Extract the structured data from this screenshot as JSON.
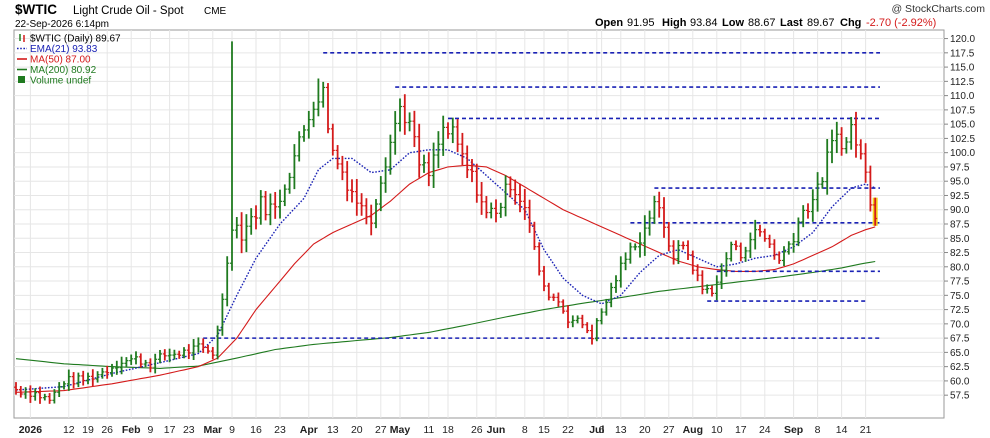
{
  "header": {
    "symbol": "$WTIC",
    "description": "Light Crude Oil - Spot",
    "exchange": "CME",
    "date": "22-Sep-2026 6:14pm",
    "copyright": "@ StockCharts.com",
    "quote": {
      "open_label": "Open",
      "open": "91.95",
      "high_label": "High",
      "high": "93.84",
      "low_label": "Low",
      "low": "88.67",
      "last_label": "Last",
      "last": "89.67",
      "chg_label": "Chg",
      "chg": "-2.70 (-2.92%)"
    }
  },
  "legend": [
    {
      "text": "$WTIC (Daily) 89.67",
      "color": "#000000",
      "marker": "bar"
    },
    {
      "text": "EMA(21) 93.83",
      "color": "#1a22b5",
      "marker": "dotted"
    },
    {
      "text": "MA(50) 87.00",
      "color": "#d41a1a",
      "marker": "line"
    },
    {
      "text": "MA(200) 80.92",
      "color": "#1f7a1f",
      "marker": "line"
    },
    {
      "text": "Volume undef",
      "color": "#1f7a1f",
      "marker": "box"
    }
  ],
  "chart_data": {
    "type": "ohlc",
    "title": "$WTIC Light Crude Oil - Spot CME",
    "ylim": [
      53.5,
      121.5
    ],
    "y_ticks": [
      57.5,
      60.0,
      62.5,
      65.0,
      67.5,
      70.0,
      72.5,
      75.0,
      77.5,
      80.0,
      82.5,
      85.0,
      87.5,
      90.0,
      92.5,
      95.0,
      97.5,
      100.0,
      102.5,
      105.0,
      107.5,
      110.0,
      112.5,
      115.0,
      117.5,
      120.0
    ],
    "y_tick_labels": [
      "57.5",
      "60.0",
      "62.5",
      "65.0",
      "67.5",
      "70.0",
      "72.5",
      "75.0",
      "77.5",
      "80.0",
      "82.5",
      "85.0",
      "87.5",
      "90.0",
      "92.5",
      "95.0",
      "97.5",
      "100.0",
      "102.5",
      "105.0",
      "107.5",
      "110.0",
      "112.5",
      "115.0",
      "117.5",
      "120.0"
    ],
    "x_range": [
      0,
      188
    ],
    "x_ticks": [
      {
        "i": 3,
        "label": "2026"
      },
      {
        "i": 11,
        "label": "12"
      },
      {
        "i": 15,
        "label": "19"
      },
      {
        "i": 19,
        "label": "26"
      },
      {
        "i": 24,
        "label": "Feb"
      },
      {
        "i": 28,
        "label": "9"
      },
      {
        "i": 32,
        "label": "17"
      },
      {
        "i": 36,
        "label": "23"
      },
      {
        "i": 41,
        "label": "Mar"
      },
      {
        "i": 45,
        "label": "9"
      },
      {
        "i": 50,
        "label": "16"
      },
      {
        "i": 55,
        "label": "23"
      },
      {
        "i": 61,
        "label": "Apr"
      },
      {
        "i": 66,
        "label": "13"
      },
      {
        "i": 71,
        "label": "20"
      },
      {
        "i": 76,
        "label": "27"
      },
      {
        "i": 80,
        "label": "May"
      },
      {
        "i": 86,
        "label": "11"
      },
      {
        "i": 90,
        "label": "18"
      },
      {
        "i": 96,
        "label": "26"
      },
      {
        "i": 100,
        "label": "Jun"
      },
      {
        "i": 106,
        "label": "8"
      },
      {
        "i": 110,
        "label": "15"
      },
      {
        "i": 115,
        "label": "22"
      },
      {
        "i": 121,
        "label": "Jul"
      },
      {
        "i": 122,
        "label": "6"
      },
      {
        "i": 126,
        "label": "13"
      },
      {
        "i": 131,
        "label": "20"
      },
      {
        "i": 136,
        "label": "27"
      },
      {
        "i": 141,
        "label": "Aug"
      },
      {
        "i": 146,
        "label": "10"
      },
      {
        "i": 151,
        "label": "17"
      },
      {
        "i": 156,
        "label": "24"
      },
      {
        "i": 162,
        "label": "Sep"
      },
      {
        "i": 167,
        "label": "8"
      },
      {
        "i": 172,
        "label": "14"
      },
      {
        "i": 177,
        "label": "21"
      }
    ],
    "close_anchors": [
      [
        0,
        58.5
      ],
      [
        4,
        57.8
      ],
      [
        7,
        56.6
      ],
      [
        10,
        60.0
      ],
      [
        14,
        60.2
      ],
      [
        18,
        61.5
      ],
      [
        22,
        63.5
      ],
      [
        25,
        63.8
      ],
      [
        28,
        63.0
      ],
      [
        31,
        64.5
      ],
      [
        35,
        65.0
      ],
      [
        38,
        65.8
      ],
      [
        41,
        64.8
      ],
      [
        43,
        74.0
      ],
      [
        45,
        88.0
      ],
      [
        47,
        86.0
      ],
      [
        51,
        91.0
      ],
      [
        54,
        90.0
      ],
      [
        57,
        97.0
      ],
      [
        60,
        104.0
      ],
      [
        62,
        109.0
      ],
      [
        64,
        110.5
      ],
      [
        66,
        100.0
      ],
      [
        69,
        95.0
      ],
      [
        72,
        90.0
      ],
      [
        74,
        89.0
      ],
      [
        77,
        99.0
      ],
      [
        80,
        108.0
      ],
      [
        82,
        105.0
      ],
      [
        84,
        98.0
      ],
      [
        86,
        96.0
      ],
      [
        89,
        104.0
      ],
      [
        91,
        103.0
      ],
      [
        94,
        97.0
      ],
      [
        96,
        94.0
      ],
      [
        98,
        89.0
      ],
      [
        101,
        91.0
      ],
      [
        103,
        95.0
      ],
      [
        106,
        91.0
      ],
      [
        108,
        83.0
      ],
      [
        110,
        76.0
      ],
      [
        113,
        74.0
      ],
      [
        115,
        71.0
      ],
      [
        118,
        70.0
      ],
      [
        120,
        68.0
      ],
      [
        122,
        72.0
      ],
      [
        124,
        76.0
      ],
      [
        126,
        80.0
      ],
      [
        128,
        83.0
      ],
      [
        131,
        86.5
      ],
      [
        133,
        92.0
      ],
      [
        135,
        86.0
      ],
      [
        137,
        82.0
      ],
      [
        139,
        84.0
      ],
      [
        141,
        80.0
      ],
      [
        143,
        76.0
      ],
      [
        145,
        76.0
      ],
      [
        147,
        79.0
      ],
      [
        149,
        84.0
      ],
      [
        151,
        82.0
      ],
      [
        153,
        85.0
      ],
      [
        155,
        86.0
      ],
      [
        157,
        84.0
      ],
      [
        159,
        81.0
      ],
      [
        161,
        84.0
      ],
      [
        163,
        88.0
      ],
      [
        165,
        91.0
      ],
      [
        167,
        93.0
      ],
      [
        169,
        99.0
      ],
      [
        171,
        103.0
      ],
      [
        173,
        101.5
      ],
      [
        174,
        104.5
      ],
      [
        175,
        102.0
      ],
      [
        176,
        99.5
      ],
      [
        177,
        96.0
      ],
      [
        178,
        92.4
      ],
      [
        179,
        89.67
      ]
    ],
    "spikes": [
      {
        "i": 45,
        "high": 119.5
      },
      {
        "i": 63,
        "high": 113.0
      },
      {
        "i": 80,
        "high": 109.5
      }
    ],
    "highlight_last": true,
    "highlight_color": "#f2d21a",
    "ema21": [
      [
        0,
        58.4
      ],
      [
        10,
        59.0
      ],
      [
        20,
        61.3
      ],
      [
        30,
        63.2
      ],
      [
        38,
        64.8
      ],
      [
        42,
        68.0
      ],
      [
        46,
        75.0
      ],
      [
        50,
        81.5
      ],
      [
        55,
        87.5
      ],
      [
        60,
        92.0
      ],
      [
        63,
        97.0
      ],
      [
        66,
        99.0
      ],
      [
        70,
        99.0
      ],
      [
        74,
        96.5
      ],
      [
        78,
        97.0
      ],
      [
        82,
        100.0
      ],
      [
        86,
        100.5
      ],
      [
        90,
        100.5
      ],
      [
        94,
        99.0
      ],
      [
        98,
        96.0
      ],
      [
        102,
        93.0
      ],
      [
        106,
        90.0
      ],
      [
        110,
        83.0
      ],
      [
        114,
        78.0
      ],
      [
        118,
        75.0
      ],
      [
        122,
        73.5
      ],
      [
        126,
        75.0
      ],
      [
        130,
        79.0
      ],
      [
        134,
        82.0
      ],
      [
        138,
        83.0
      ],
      [
        142,
        81.5
      ],
      [
        146,
        80.0
      ],
      [
        150,
        80.5
      ],
      [
        154,
        81.5
      ],
      [
        158,
        82.0
      ],
      [
        162,
        83.5
      ],
      [
        166,
        86.0
      ],
      [
        170,
        90.5
      ],
      [
        174,
        93.8
      ],
      [
        177,
        94.5
      ],
      [
        179,
        93.83
      ]
    ],
    "ma50": [
      [
        0,
        58.0
      ],
      [
        10,
        58.3
      ],
      [
        20,
        59.5
      ],
      [
        30,
        61.0
      ],
      [
        38,
        62.5
      ],
      [
        42,
        64.0
      ],
      [
        46,
        67.5
      ],
      [
        50,
        72.5
      ],
      [
        54,
        76.5
      ],
      [
        58,
        80.5
      ],
      [
        62,
        84.0
      ],
      [
        66,
        86.0
      ],
      [
        70,
        87.5
      ],
      [
        74,
        89.0
      ],
      [
        78,
        91.5
      ],
      [
        82,
        94.5
      ],
      [
        86,
        96.5
      ],
      [
        90,
        97.5
      ],
      [
        94,
        97.8
      ],
      [
        98,
        97.5
      ],
      [
        102,
        96.0
      ],
      [
        106,
        94.0
      ],
      [
        110,
        92.0
      ],
      [
        114,
        90.0
      ],
      [
        118,
        88.5
      ],
      [
        122,
        87.0
      ],
      [
        126,
        85.5
      ],
      [
        130,
        84.0
      ],
      [
        134,
        82.5
      ],
      [
        138,
        81.0
      ],
      [
        142,
        80.0
      ],
      [
        146,
        79.5
      ],
      [
        150,
        79.2
      ],
      [
        154,
        79.2
      ],
      [
        158,
        79.5
      ],
      [
        162,
        80.5
      ],
      [
        166,
        82.0
      ],
      [
        170,
        83.5
      ],
      [
        174,
        85.5
      ],
      [
        177,
        86.5
      ],
      [
        179,
        87.0
      ]
    ],
    "ma200": [
      [
        0,
        63.9
      ],
      [
        10,
        63.0
      ],
      [
        20,
        62.5
      ],
      [
        30,
        62.2
      ],
      [
        38,
        62.6
      ],
      [
        46,
        64.0
      ],
      [
        54,
        65.5
      ],
      [
        62,
        66.4
      ],
      [
        70,
        67.0
      ],
      [
        78,
        67.6
      ],
      [
        86,
        68.5
      ],
      [
        94,
        69.8
      ],
      [
        102,
        71.2
      ],
      [
        110,
        72.5
      ],
      [
        118,
        73.6
      ],
      [
        126,
        74.6
      ],
      [
        134,
        75.7
      ],
      [
        142,
        76.5
      ],
      [
        150,
        77.3
      ],
      [
        158,
        78.1
      ],
      [
        166,
        79.0
      ],
      [
        172,
        79.8
      ],
      [
        176,
        80.5
      ],
      [
        179,
        80.92
      ]
    ],
    "resistance_lines": [
      {
        "y": 117.5,
        "x_start": 64,
        "x_end": 180
      },
      {
        "y": 111.5,
        "x_start": 79,
        "x_end": 180
      },
      {
        "y": 106.0,
        "x_start": 90,
        "x_end": 180
      },
      {
        "y": 93.8,
        "x_start": 133,
        "x_end": 180
      },
      {
        "y": 87.7,
        "x_start": 128,
        "x_end": 180
      },
      {
        "y": 79.2,
        "x_start": 146,
        "x_end": 180
      },
      {
        "y": 74.0,
        "x_start": 144,
        "x_end": 177
      },
      {
        "y": 67.5,
        "x_start": 39,
        "x_end": 180
      }
    ],
    "colors": {
      "up": "#1f7a1f",
      "down": "#d41a1a",
      "ema": "#1a22b5",
      "ma50": "#d41a1a",
      "ma200": "#1f7a1f",
      "level": "#1a22b5",
      "grid": "#e6e6e6",
      "frame": "#9a9a9a"
    }
  }
}
